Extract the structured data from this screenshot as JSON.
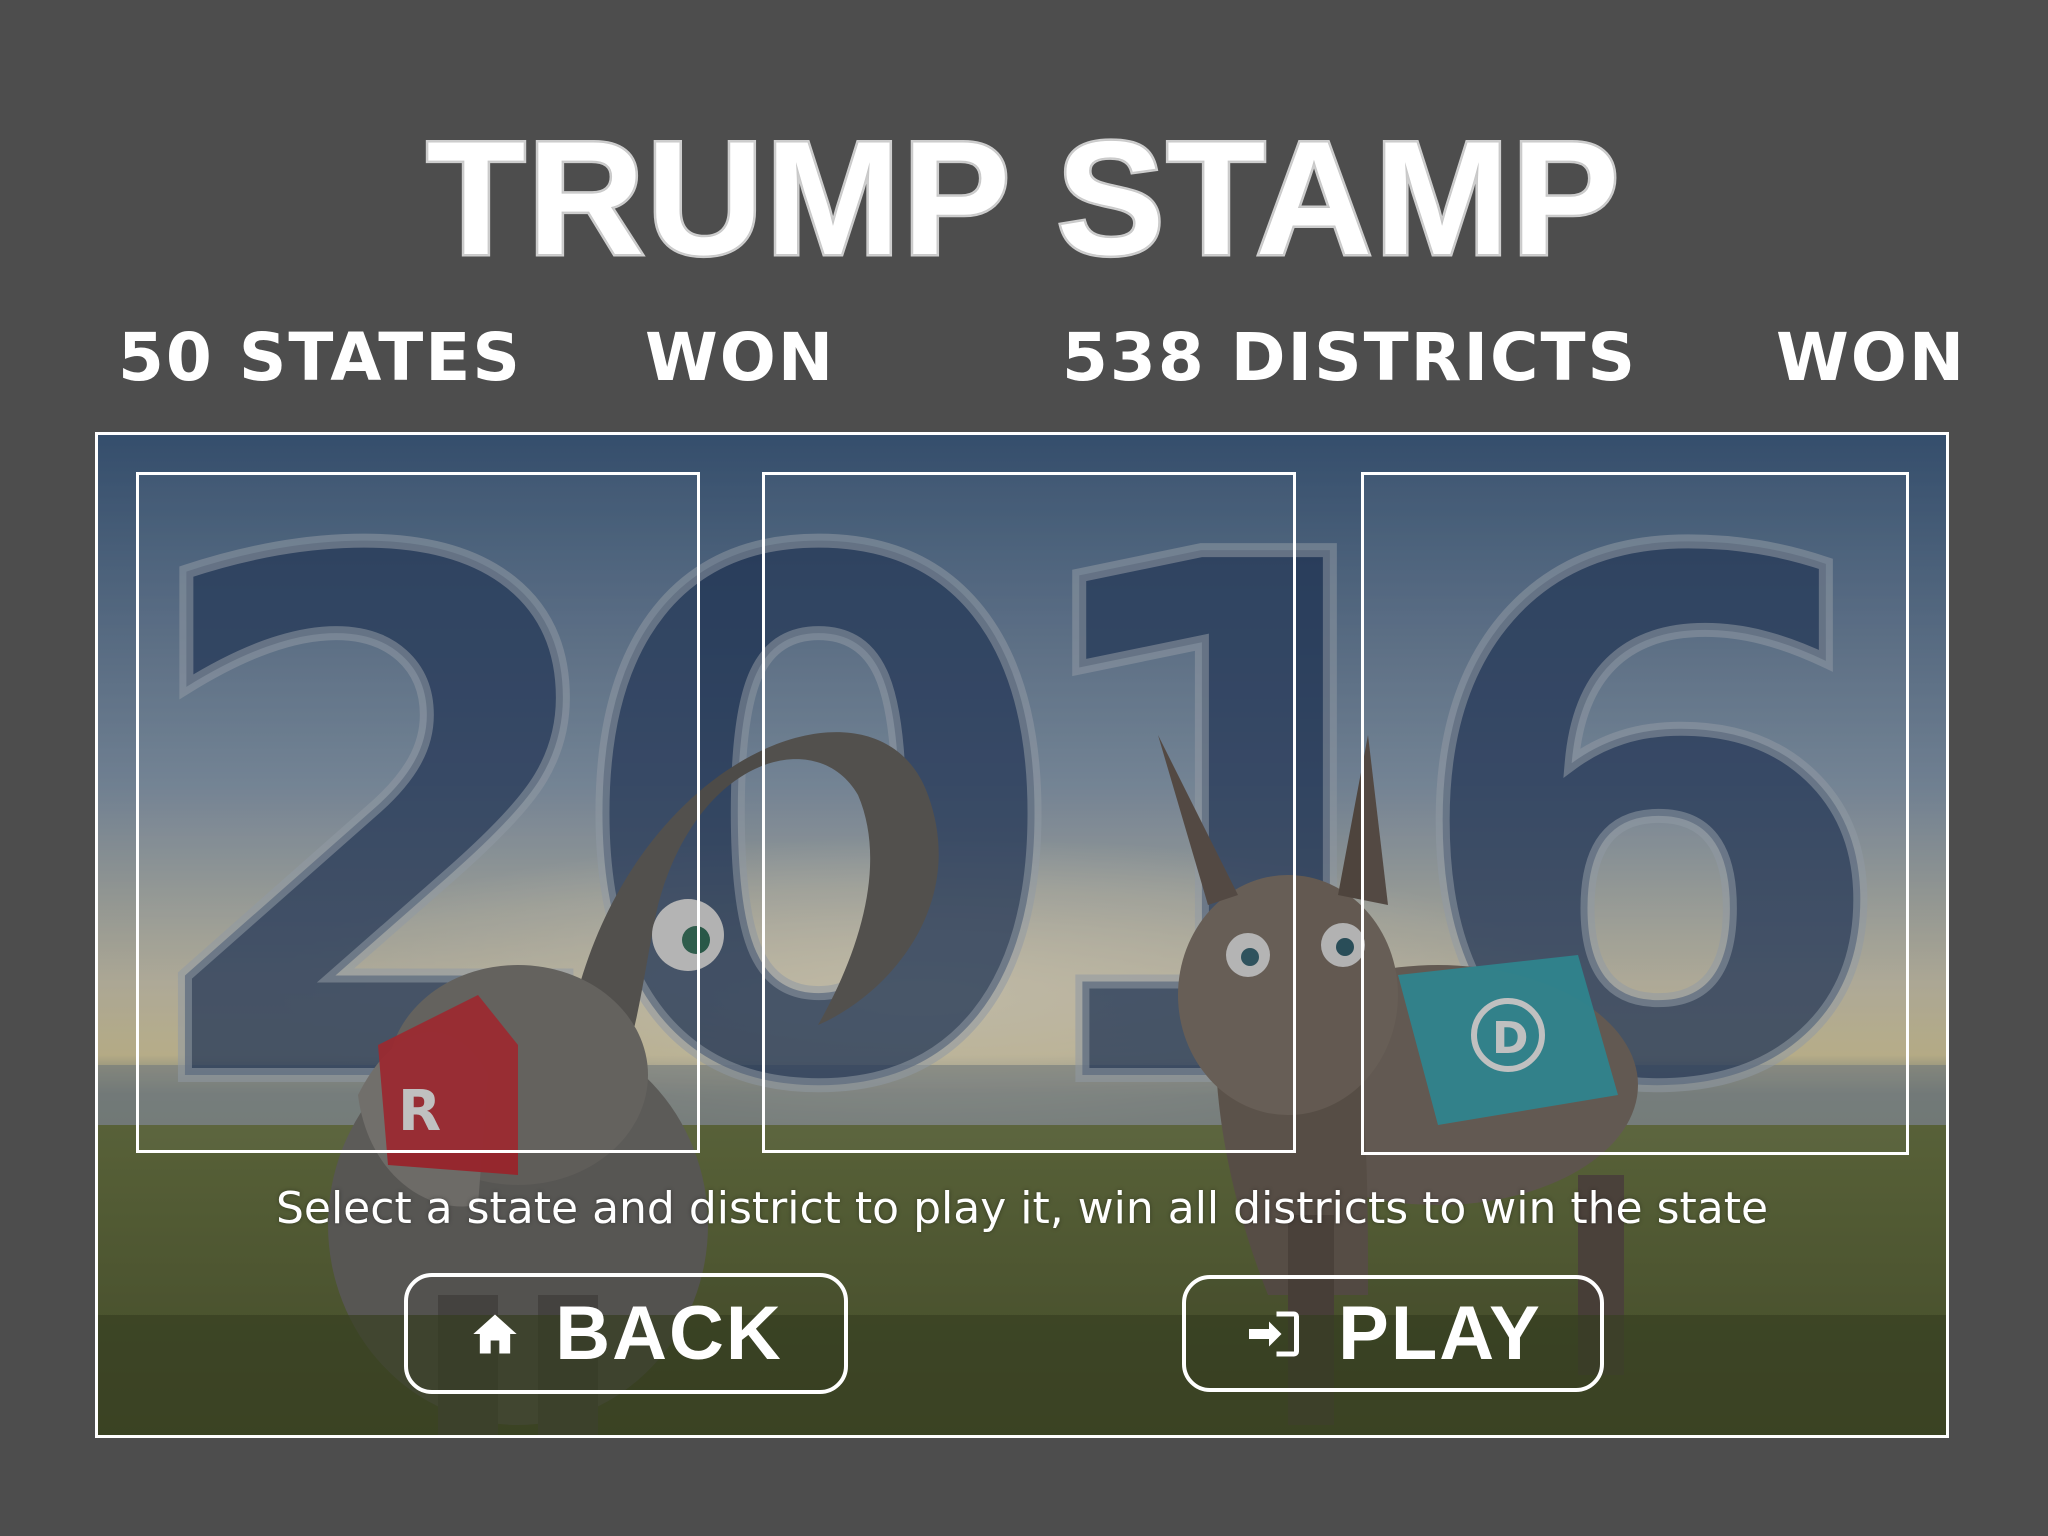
{
  "header": {
    "title": "TRUMP STAMP"
  },
  "stats": {
    "states_label": "50 STATES",
    "states_won_label": "WON",
    "districts_label": "538 DISTRICTS",
    "districts_won_label": "WON"
  },
  "scene": {
    "year_text": "2016"
  },
  "main": {
    "instruction": "Select a state and district to play it, win all districts to win the state"
  },
  "buttons": {
    "back_label": "BACK",
    "back_icon": "home-icon",
    "play_label": "PLAY",
    "play_icon": "login-icon"
  },
  "colors": {
    "background": "#4d4d4d",
    "republican_red": "#c8232c",
    "democrat_teal": "#2aa7b5",
    "sky_blue": "#2d4b73"
  }
}
